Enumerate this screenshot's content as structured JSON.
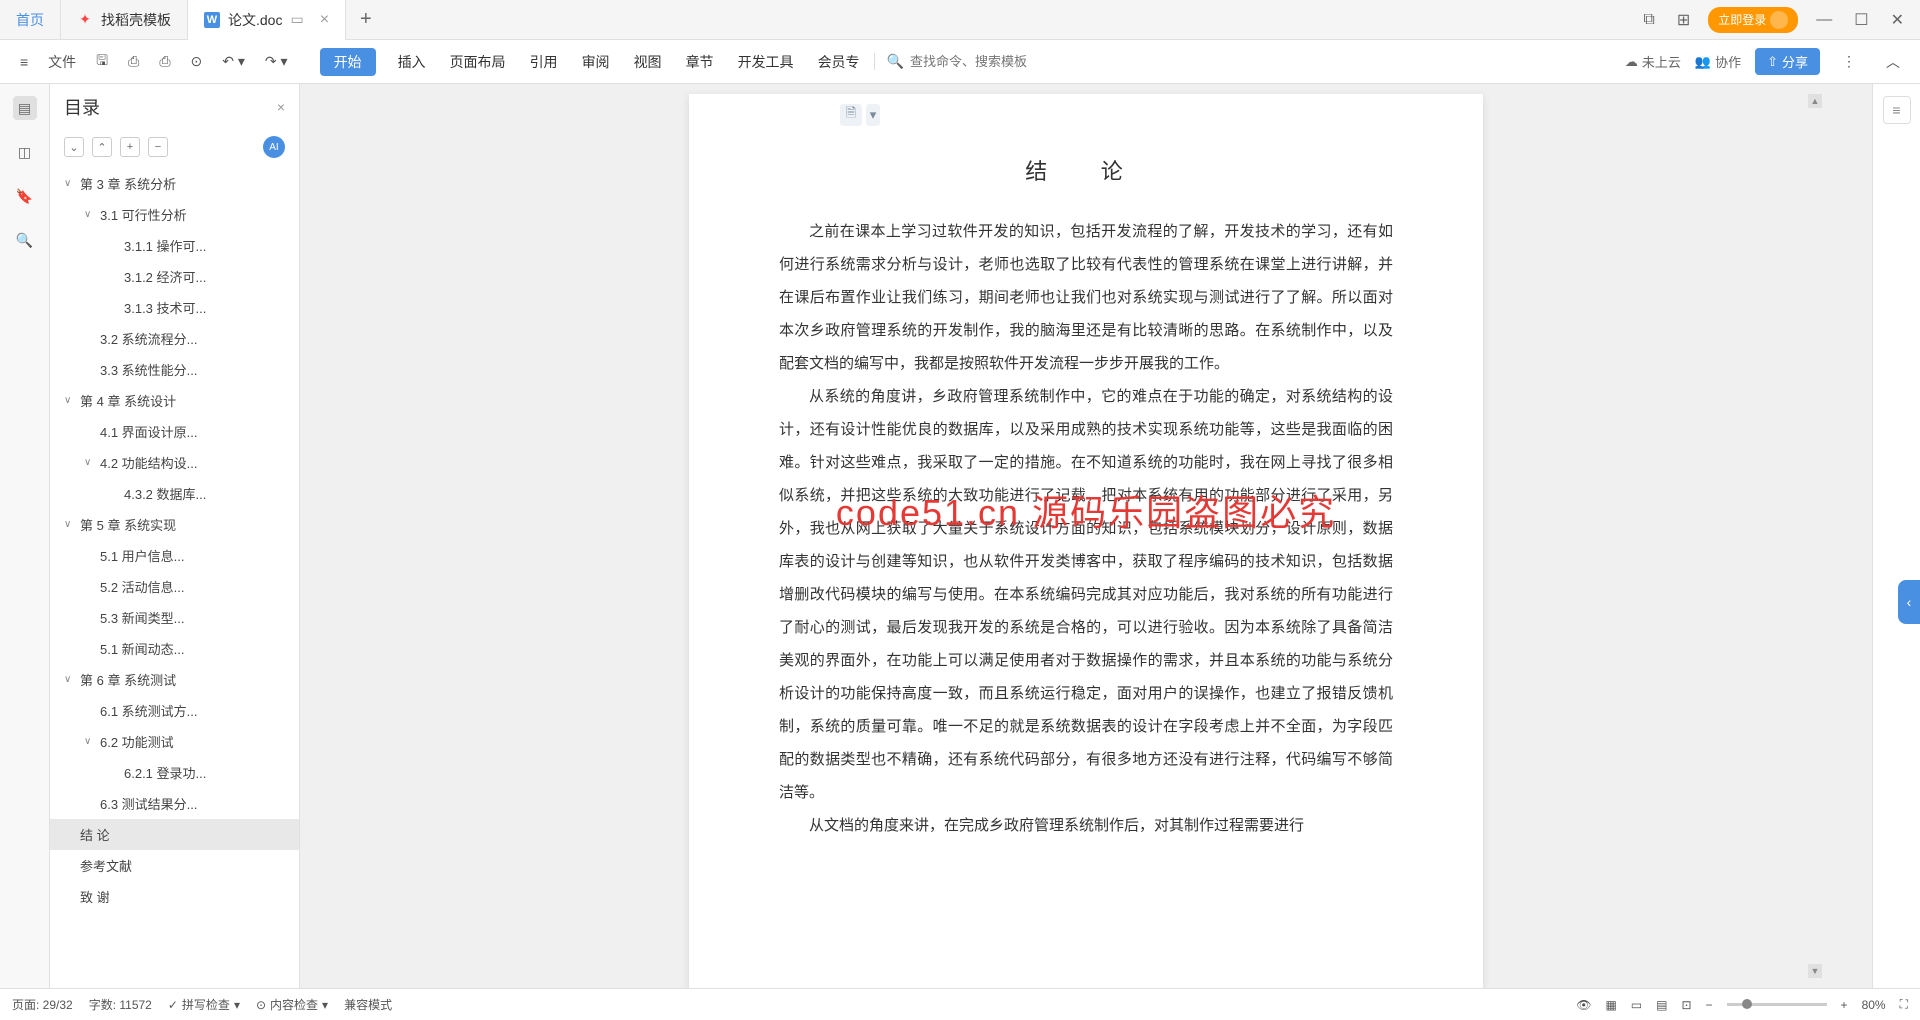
{
  "titlebar": {
    "home": "首页",
    "template_tab": "找稻壳模板",
    "doc_tab": "论文.doc",
    "doc_icon": "W",
    "login": "立即登录"
  },
  "toolbar": {
    "file": "文件",
    "menus": [
      "开始",
      "插入",
      "页面布局",
      "引用",
      "审阅",
      "视图",
      "章节",
      "开发工具",
      "会员专"
    ],
    "search_placeholder": "查找命令、搜索模板",
    "cloud": "未上云",
    "collab": "协作",
    "share": "分享"
  },
  "outline": {
    "title": "目录",
    "ai": "AI",
    "items": [
      {
        "lv": 1,
        "toggle": "∨",
        "text": "第 3 章  系统分析"
      },
      {
        "lv": 2,
        "toggle": "∨",
        "text": "3.1 可行性分析"
      },
      {
        "lv": 3,
        "text": "3.1.1 操作可..."
      },
      {
        "lv": 3,
        "text": "3.1.2 经济可..."
      },
      {
        "lv": 3,
        "text": "3.1.3 技术可..."
      },
      {
        "lv": 2,
        "text": "3.2 系统流程分..."
      },
      {
        "lv": 2,
        "text": "3.3 系统性能分..."
      },
      {
        "lv": 1,
        "toggle": "∨",
        "text": "第 4 章   系统设计"
      },
      {
        "lv": 2,
        "text": "4.1 界面设计原..."
      },
      {
        "lv": 2,
        "toggle": "∨",
        "text": "4.2 功能结构设..."
      },
      {
        "lv": 3,
        "text": "4.3.2 数据库..."
      },
      {
        "lv": 1,
        "toggle": "∨",
        "text": "第 5 章  系统实现"
      },
      {
        "lv": 2,
        "text": "5.1 用户信息..."
      },
      {
        "lv": 2,
        "text": "5.2 活动信息..."
      },
      {
        "lv": 2,
        "text": "5.3 新闻类型..."
      },
      {
        "lv": 2,
        "text": "5.1 新闻动态..."
      },
      {
        "lv": 1,
        "toggle": "∨",
        "text": "第 6 章  系统测试"
      },
      {
        "lv": 2,
        "text": "6.1 系统测试方..."
      },
      {
        "lv": 2,
        "toggle": "∨",
        "text": "6.2 功能测试"
      },
      {
        "lv": 3,
        "text": "6.2.1 登录功..."
      },
      {
        "lv": 2,
        "text": "6.3 测试结果分..."
      },
      {
        "lv": 1,
        "text": "结   论",
        "selected": true
      },
      {
        "lv": 1,
        "text": "参考文献"
      },
      {
        "lv": 1,
        "text": "致  谢"
      }
    ]
  },
  "document": {
    "title": "结   论",
    "para1": "之前在课本上学习过软件开发的知识，包括开发流程的了解，开发技术的学习，还有如何进行系统需求分析与设计，老师也选取了比较有代表性的管理系统在课堂上进行讲解，并在课后布置作业让我们练习，期间老师也让我们也对系统实现与测试进行了了解。所以面对本次乡政府管理系统的开发制作，我的脑海里还是有比较清晰的思路。在系统制作中，以及配套文档的编写中，我都是按照软件开发流程一步步开展我的工作。",
    "para2": "从系统的角度讲，乡政府管理系统制作中，它的难点在于功能的确定，对系统结构的设计，还有设计性能优良的数据库，以及采用成熟的技术实现系统功能等，这些是我面临的困难。针对这些难点，我采取了一定的措施。在不知道系统的功能时，我在网上寻找了很多相似系统，并把这些系统的大致功能进行了记载，把对本系统有用的功能部分进行了采用，另外，我也从网上获取了大量关于系统设计方面的知识，包括系统模块划分，设计原则，数据库表的设计与创建等知识，也从软件开发类博客中，获取了程序编码的技术知识，包括数据增删改代码模块的编写与使用。在本系统编码完成其对应功能后，我对系统的所有功能进行了耐心的测试，最后发现我开发的系统是合格的，可以进行验收。因为本系统除了具备简洁美观的界面外，在功能上可以满足使用者对于数据操作的需求，并且本系统的功能与系统分析设计的功能保持高度一致，而且系统运行稳定，面对用户的误操作，也建立了报错反馈机制，系统的质量可靠。唯一不足的就是系统数据表的设计在字段考虑上并不全面，为字段匹配的数据类型也不精确，还有系统代码部分，有很多地方还没有进行注释，代码编写不够简洁等。",
    "para3": "从文档的角度来讲，在完成乡政府管理系统制作后，对其制作过程需要进行"
  },
  "watermark": "code51.cn  源码乐园盗图必究",
  "statusbar": {
    "page": "页面: 29/32",
    "words": "字数: 11572",
    "spell": "拼写检查",
    "content": "内容检查",
    "compat": "兼容模式",
    "zoom": "80%"
  }
}
